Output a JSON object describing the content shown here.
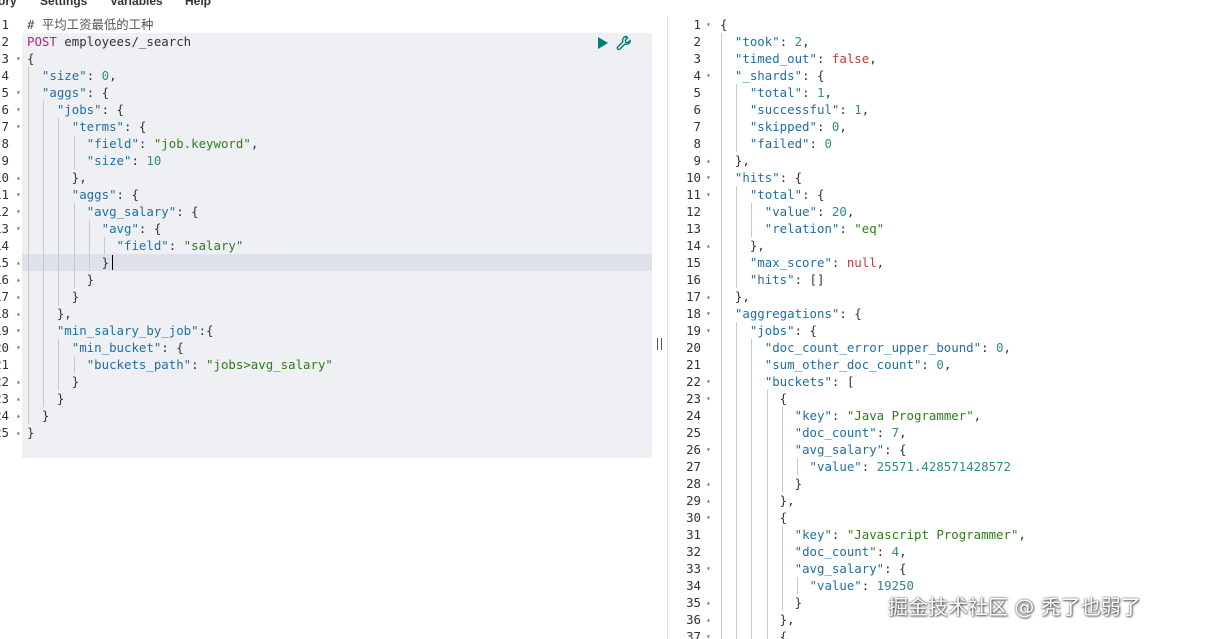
{
  "menu": {
    "history": "ory",
    "settings": "Settings",
    "variables": "Variables",
    "help": "Help"
  },
  "icons": {
    "run": "play-icon",
    "options": "wrench-icon"
  },
  "request": {
    "lines": [
      [
        [
          "c",
          "# 平均工资最低的工种"
        ]
      ],
      [
        [
          "m",
          "POST"
        ],
        [
          "p",
          " employees/_search"
        ]
      ],
      [
        [
          "p",
          "{"
        ]
      ],
      [
        [
          "p",
          "  "
        ],
        [
          "k",
          "\"size\""
        ],
        [
          "p",
          ": "
        ],
        [
          "n",
          "0"
        ],
        [
          "p",
          ","
        ]
      ],
      [
        [
          "p",
          "  "
        ],
        [
          "k",
          "\"aggs\""
        ],
        [
          "p",
          ": {"
        ]
      ],
      [
        [
          "p",
          "    "
        ],
        [
          "k",
          "\"jobs\""
        ],
        [
          "p",
          ": {"
        ]
      ],
      [
        [
          "p",
          "      "
        ],
        [
          "k",
          "\"terms\""
        ],
        [
          "p",
          ": {"
        ]
      ],
      [
        [
          "p",
          "        "
        ],
        [
          "k",
          "\"field\""
        ],
        [
          "p",
          ": "
        ],
        [
          "s",
          "\"job.keyword\""
        ],
        [
          "p",
          ","
        ]
      ],
      [
        [
          "p",
          "        "
        ],
        [
          "k",
          "\"size\""
        ],
        [
          "p",
          ": "
        ],
        [
          "n",
          "10"
        ]
      ],
      [
        [
          "p",
          "      },"
        ]
      ],
      [
        [
          "p",
          "      "
        ],
        [
          "k",
          "\"aggs\""
        ],
        [
          "p",
          ": {"
        ]
      ],
      [
        [
          "p",
          "        "
        ],
        [
          "k",
          "\"avg_salary\""
        ],
        [
          "p",
          ": {"
        ]
      ],
      [
        [
          "p",
          "          "
        ],
        [
          "k",
          "\"avg\""
        ],
        [
          "p",
          ": {"
        ]
      ],
      [
        [
          "p",
          "            "
        ],
        [
          "k",
          "\"field\""
        ],
        [
          "p",
          ": "
        ],
        [
          "s",
          "\"salary\""
        ]
      ],
      [
        [
          "p",
          "          }"
        ]
      ],
      [
        [
          "p",
          "        }"
        ]
      ],
      [
        [
          "p",
          "      }"
        ]
      ],
      [
        [
          "p",
          "    },"
        ]
      ],
      [
        [
          "p",
          "    "
        ],
        [
          "k",
          "\"min_salary_by_job\""
        ],
        [
          "p",
          ":{"
        ]
      ],
      [
        [
          "p",
          "      "
        ],
        [
          "k",
          "\"min_bucket\""
        ],
        [
          "p",
          ": {"
        ]
      ],
      [
        [
          "p",
          "        "
        ],
        [
          "k",
          "\"buckets_path\""
        ],
        [
          "p",
          ": "
        ],
        [
          "s",
          "\"jobs>avg_salary\""
        ]
      ],
      [
        [
          "p",
          "      }"
        ]
      ],
      [
        [
          "p",
          "    }"
        ]
      ],
      [
        [
          "p",
          "  }"
        ]
      ],
      [
        [
          "p",
          "}"
        ]
      ]
    ]
  },
  "response": {
    "lines": [
      [
        [
          "p",
          "{"
        ]
      ],
      [
        [
          "p",
          "  "
        ],
        [
          "k",
          "\"took\""
        ],
        [
          "p",
          ": "
        ],
        [
          "n",
          "2"
        ],
        [
          "p",
          ","
        ]
      ],
      [
        [
          "p",
          "  "
        ],
        [
          "k",
          "\"timed_out\""
        ],
        [
          "p",
          ": "
        ],
        [
          "b",
          "false"
        ],
        [
          "p",
          ","
        ]
      ],
      [
        [
          "p",
          "  "
        ],
        [
          "k",
          "\"_shards\""
        ],
        [
          "p",
          ": {"
        ]
      ],
      [
        [
          "p",
          "    "
        ],
        [
          "k",
          "\"total\""
        ],
        [
          "p",
          ": "
        ],
        [
          "n",
          "1"
        ],
        [
          "p",
          ","
        ]
      ],
      [
        [
          "p",
          "    "
        ],
        [
          "k",
          "\"successful\""
        ],
        [
          "p",
          ": "
        ],
        [
          "n",
          "1"
        ],
        [
          "p",
          ","
        ]
      ],
      [
        [
          "p",
          "    "
        ],
        [
          "k",
          "\"skipped\""
        ],
        [
          "p",
          ": "
        ],
        [
          "n",
          "0"
        ],
        [
          "p",
          ","
        ]
      ],
      [
        [
          "p",
          "    "
        ],
        [
          "k",
          "\"failed\""
        ],
        [
          "p",
          ": "
        ],
        [
          "n",
          "0"
        ]
      ],
      [
        [
          "p",
          "  },"
        ]
      ],
      [
        [
          "p",
          "  "
        ],
        [
          "k",
          "\"hits\""
        ],
        [
          "p",
          ": {"
        ]
      ],
      [
        [
          "p",
          "    "
        ],
        [
          "k",
          "\"total\""
        ],
        [
          "p",
          ": {"
        ]
      ],
      [
        [
          "p",
          "      "
        ],
        [
          "k",
          "\"value\""
        ],
        [
          "p",
          ": "
        ],
        [
          "n",
          "20"
        ],
        [
          "p",
          ","
        ]
      ],
      [
        [
          "p",
          "      "
        ],
        [
          "k",
          "\"relation\""
        ],
        [
          "p",
          ": "
        ],
        [
          "s",
          "\"eq\""
        ]
      ],
      [
        [
          "p",
          "    },"
        ]
      ],
      [
        [
          "p",
          "    "
        ],
        [
          "k",
          "\"max_score\""
        ],
        [
          "p",
          ": "
        ],
        [
          "b",
          "null"
        ],
        [
          "p",
          ","
        ]
      ],
      [
        [
          "p",
          "    "
        ],
        [
          "k",
          "\"hits\""
        ],
        [
          "p",
          ": []"
        ]
      ],
      [
        [
          "p",
          "  },"
        ]
      ],
      [
        [
          "p",
          "  "
        ],
        [
          "k",
          "\"aggregations\""
        ],
        [
          "p",
          ": {"
        ]
      ],
      [
        [
          "p",
          "    "
        ],
        [
          "k",
          "\"jobs\""
        ],
        [
          "p",
          ": {"
        ]
      ],
      [
        [
          "p",
          "      "
        ],
        [
          "k",
          "\"doc_count_error_upper_bound\""
        ],
        [
          "p",
          ": "
        ],
        [
          "n",
          "0"
        ],
        [
          "p",
          ","
        ]
      ],
      [
        [
          "p",
          "      "
        ],
        [
          "k",
          "\"sum_other_doc_count\""
        ],
        [
          "p",
          ": "
        ],
        [
          "n",
          "0"
        ],
        [
          "p",
          ","
        ]
      ],
      [
        [
          "p",
          "      "
        ],
        [
          "k",
          "\"buckets\""
        ],
        [
          "p",
          ": ["
        ]
      ],
      [
        [
          "p",
          "        {"
        ]
      ],
      [
        [
          "p",
          "          "
        ],
        [
          "k",
          "\"key\""
        ],
        [
          "p",
          ": "
        ],
        [
          "s",
          "\"Java Programmer\""
        ],
        [
          "p",
          ","
        ]
      ],
      [
        [
          "p",
          "          "
        ],
        [
          "k",
          "\"doc_count\""
        ],
        [
          "p",
          ": "
        ],
        [
          "n",
          "7"
        ],
        [
          "p",
          ","
        ]
      ],
      [
        [
          "p",
          "          "
        ],
        [
          "k",
          "\"avg_salary\""
        ],
        [
          "p",
          ": {"
        ]
      ],
      [
        [
          "p",
          "            "
        ],
        [
          "k",
          "\"value\""
        ],
        [
          "p",
          ": "
        ],
        [
          "n",
          "25571.428571428572"
        ]
      ],
      [
        [
          "p",
          "          }"
        ]
      ],
      [
        [
          "p",
          "        },"
        ]
      ],
      [
        [
          "p",
          "        {"
        ]
      ],
      [
        [
          "p",
          "          "
        ],
        [
          "k",
          "\"key\""
        ],
        [
          "p",
          ": "
        ],
        [
          "s",
          "\"Javascript Programmer\""
        ],
        [
          "p",
          ","
        ]
      ],
      [
        [
          "p",
          "          "
        ],
        [
          "k",
          "\"doc_count\""
        ],
        [
          "p",
          ": "
        ],
        [
          "n",
          "4"
        ],
        [
          "p",
          ","
        ]
      ],
      [
        [
          "p",
          "          "
        ],
        [
          "k",
          "\"avg_salary\""
        ],
        [
          "p",
          ": {"
        ]
      ],
      [
        [
          "p",
          "            "
        ],
        [
          "k",
          "\"value\""
        ],
        [
          "p",
          ": "
        ],
        [
          "n",
          "19250"
        ]
      ],
      [
        [
          "p",
          "          }"
        ]
      ],
      [
        [
          "p",
          "        },"
        ]
      ],
      [
        [
          "p",
          "        {"
        ]
      ]
    ]
  },
  "watermark": "掘金技术社区 @ 秃了也弱了"
}
